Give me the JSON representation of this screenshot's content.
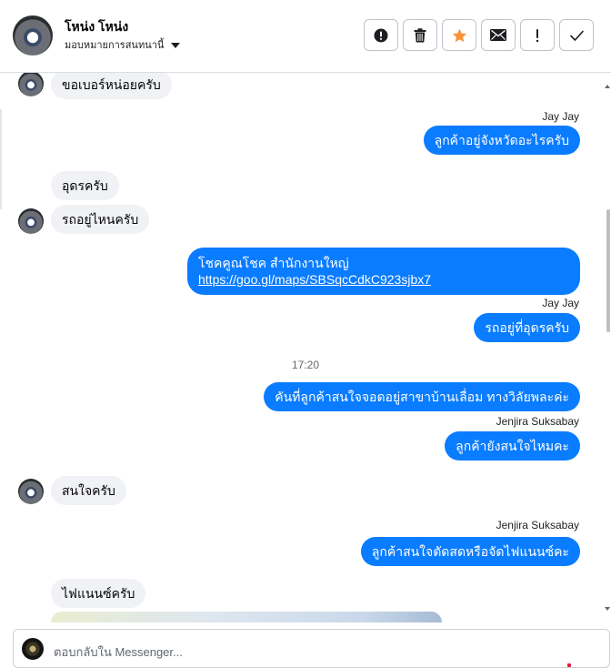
{
  "header": {
    "name": "โหน่ง โหน่ง",
    "assign_label": "มอบหมายการสนทนานี้"
  },
  "actions": [
    {
      "name": "spam-button",
      "icon": "alert-circle-icon"
    },
    {
      "name": "delete-button",
      "icon": "trash-icon"
    },
    {
      "name": "star-button",
      "icon": "star-icon"
    },
    {
      "name": "mark-unread-button",
      "icon": "envelope-icon"
    },
    {
      "name": "follow-up-button",
      "icon": "exclamation-icon"
    },
    {
      "name": "mark-done-button",
      "icon": "check-icon"
    }
  ],
  "colors": {
    "outgoing_bubble": "#0a7cff",
    "incoming_bubble": "#f0f2f5",
    "star": "#f7923b"
  },
  "messages": {
    "m1": "ขอเบอร์หน่อยครับ",
    "s1": "Jay Jay",
    "m2": "ลูกค้าอยู่จังหวัดอะไรครับ",
    "m3": "อุดรครับ",
    "m4": "รถอยู่ไหนครับ",
    "m5_line1": "โชคคูณโชค สำนักงานใหญ่",
    "m5_link": "https://goo.gl/maps/SBSqcCdkC923sjbx7",
    "s2": "Jay Jay",
    "m6": "รถอยู่ที่อุดรครับ",
    "time1": "17:20",
    "m7": "คันที่ลูกค้าสนใจจอดอยู่สาขาบ้านเลื่อม ทางวิลัยพละค่ะ",
    "s3": "Jenjira Suksabay",
    "m8": "ลูกค้ายังสนใจไหมคะ",
    "m9": "สนใจครับ",
    "s4": "Jenjira Suksabay",
    "m10": "ลูกค้าสนใจตัดสดหรือจัดไฟแนนซ์คะ",
    "m11": "ไฟแนนซ์ครับ"
  },
  "reply": {
    "placeholder": "ตอบกลับใน Messenger..."
  }
}
